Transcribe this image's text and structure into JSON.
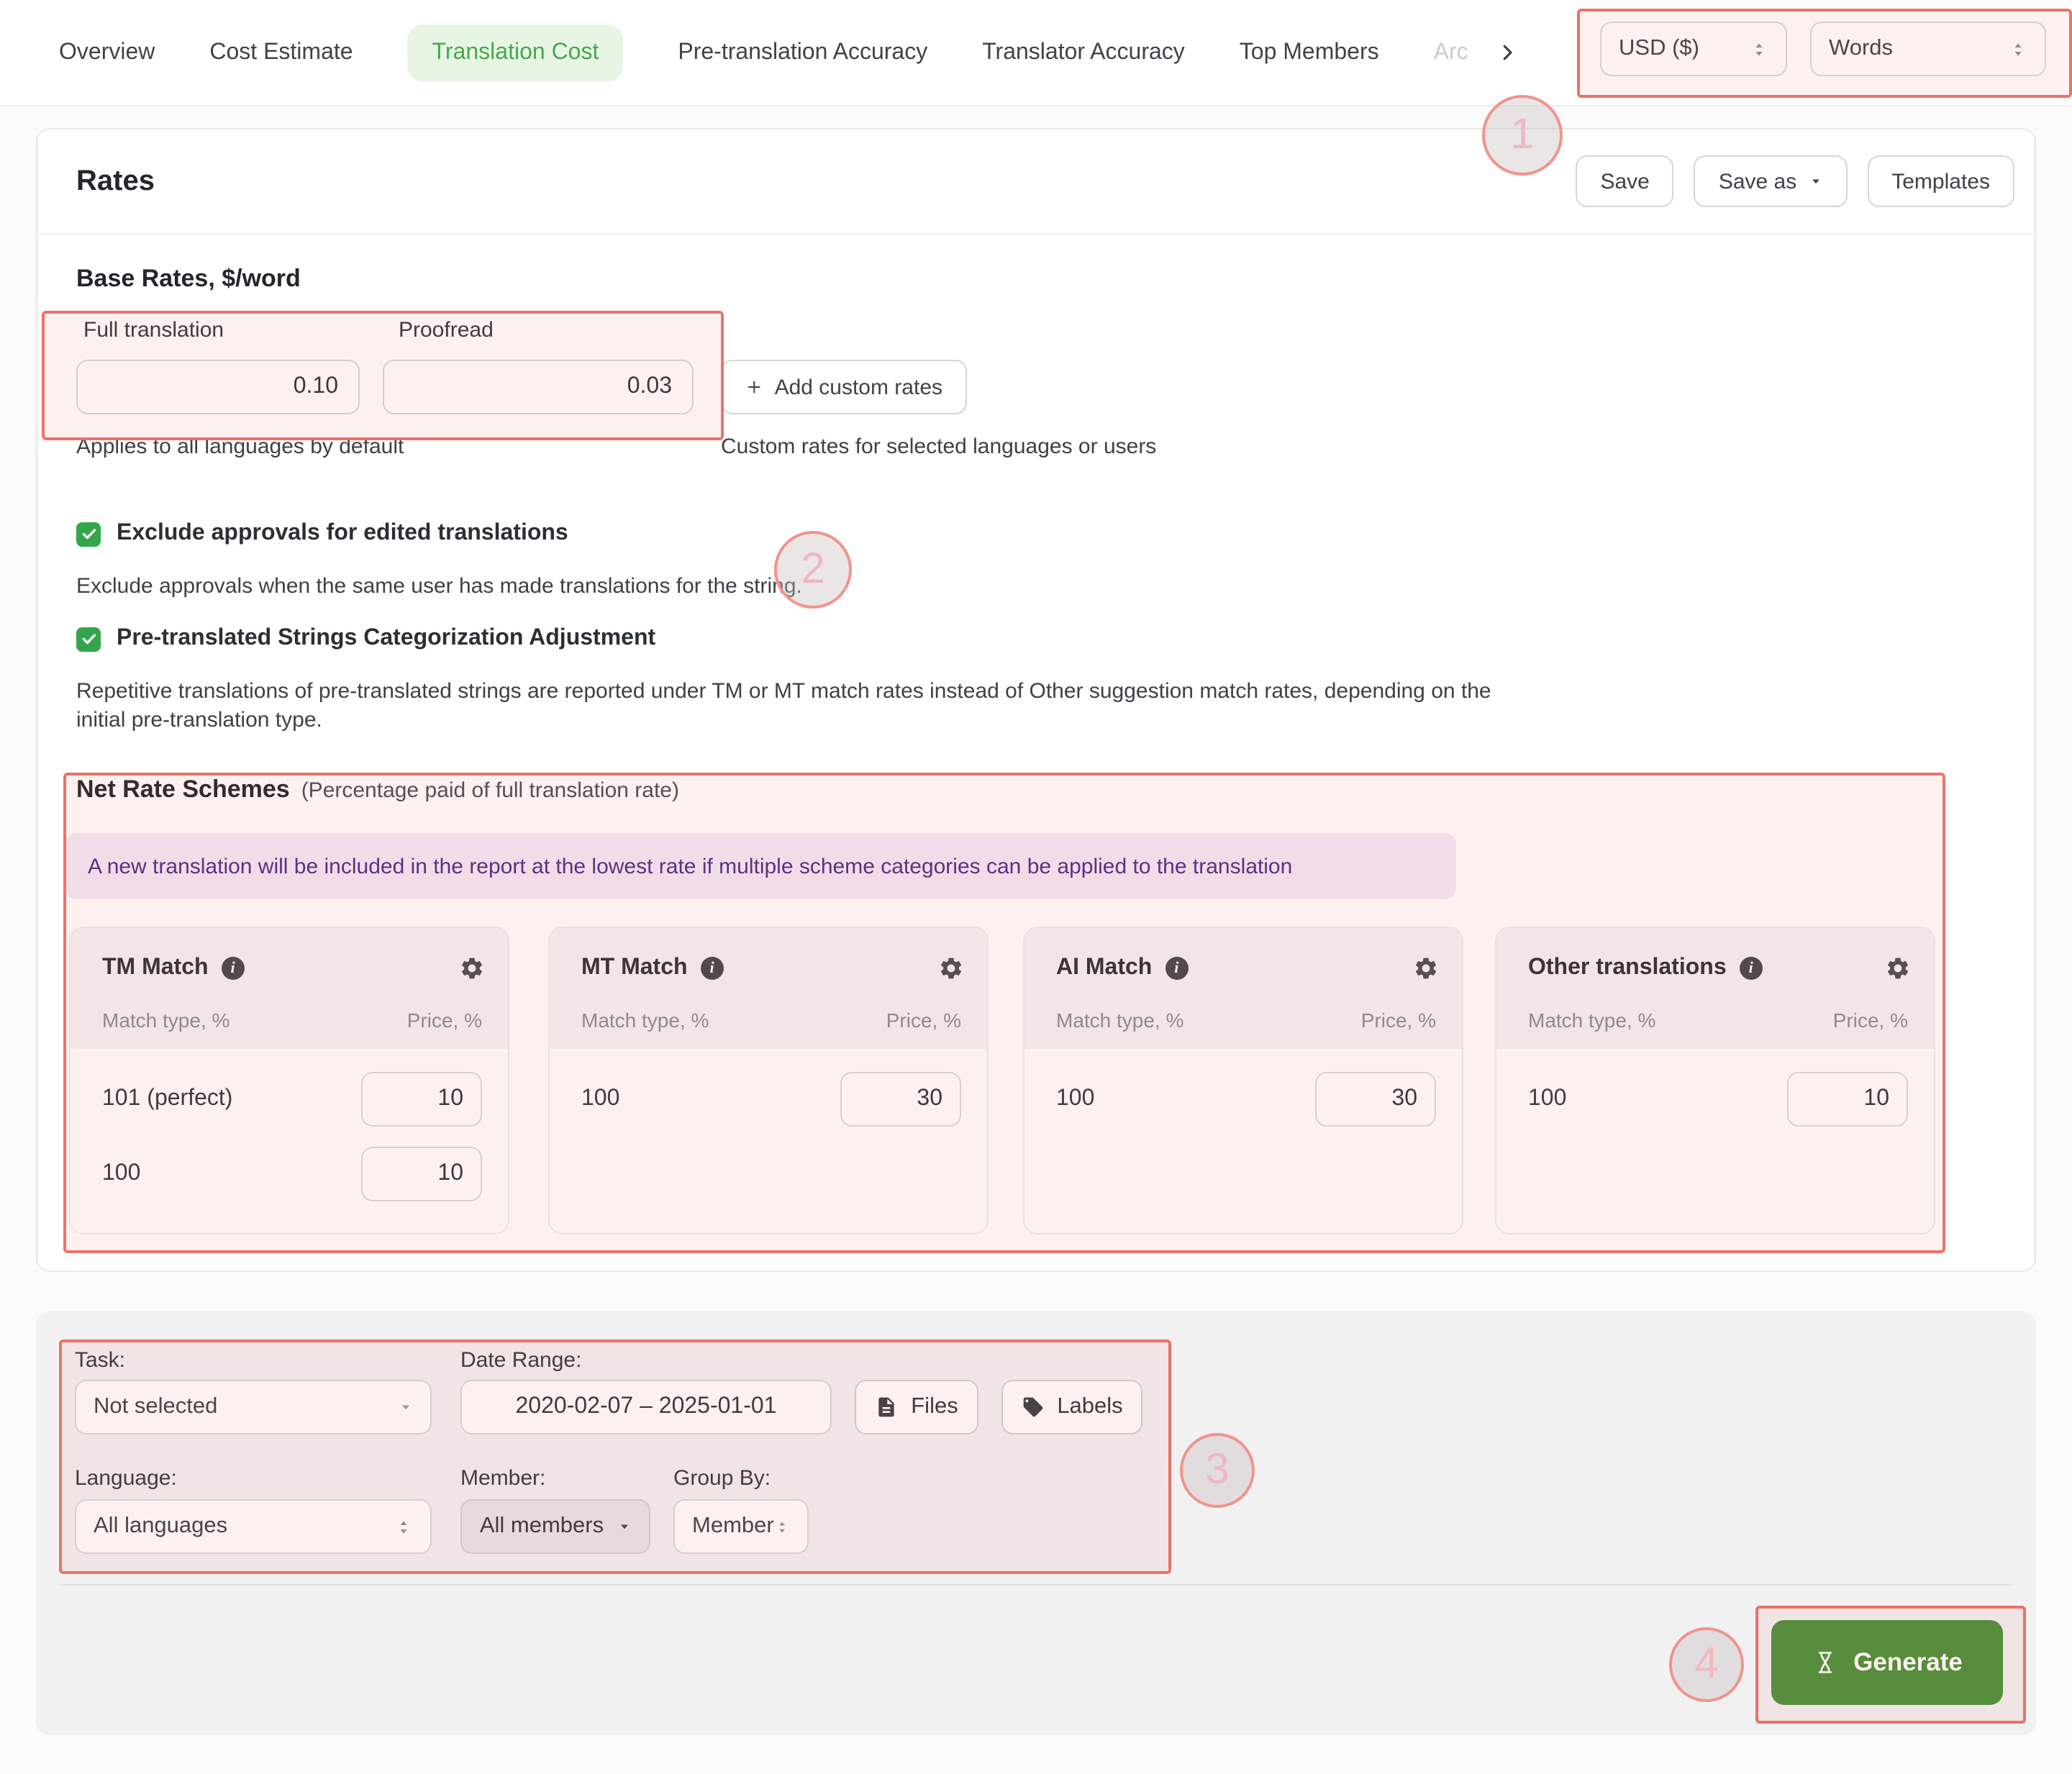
{
  "nav": {
    "tabs": [
      "Overview",
      "Cost Estimate",
      "Translation Cost",
      "Pre-translation Accuracy",
      "Translator Accuracy",
      "Top Members"
    ],
    "truncated_tab": "Arc",
    "currency": "USD ($)",
    "units": "Words"
  },
  "rates_panel": {
    "title": "Rates",
    "save": "Save",
    "save_as": "Save as",
    "templates": "Templates",
    "base_rates": {
      "heading": "Base Rates, $/word",
      "full_label": "Full translation",
      "full_value": "0.10",
      "proofread_label": "Proofread",
      "proofread_value": "0.03",
      "add_custom": "Add custom rates",
      "note_left": "Applies to all languages by default",
      "note_right": "Custom rates for selected languages or users"
    },
    "options": [
      {
        "label": "Exclude approvals for edited translations",
        "description": "Exclude approvals when the same user has made translations for the string.",
        "checked": true
      },
      {
        "label": "Pre-translated Strings Categorization Adjustment",
        "description": "Repetitive translations of pre-translated strings are reported under TM or MT match rates instead of Other suggestion match rates, depending on the initial pre-translation type.",
        "checked": true
      }
    ],
    "net_rate_schemes": {
      "heading": "Net Rate Schemes",
      "subheading": "(Percentage paid of full translation rate)",
      "info": "A new translation will be included in the report at the lowest rate if multiple scheme categories can be applied to the translation",
      "match_type_col": "Match type, %",
      "price_col": "Price, %",
      "cards": [
        {
          "title": "TM Match",
          "rows": [
            {
              "match": "101 (perfect)",
              "price": "10"
            },
            {
              "match": "100",
              "price": "10"
            }
          ]
        },
        {
          "title": "MT Match",
          "rows": [
            {
              "match": "100",
              "price": "30"
            }
          ]
        },
        {
          "title": "AI Match",
          "rows": [
            {
              "match": "100",
              "price": "30"
            }
          ]
        },
        {
          "title": "Other translations",
          "rows": [
            {
              "match": "100",
              "price": "10"
            }
          ]
        }
      ]
    }
  },
  "filters": {
    "task_label": "Task:",
    "task_value": "Not selected",
    "date_label": "Date Range:",
    "date_value": "2020-02-07 – 2025-01-01",
    "files": "Files",
    "labels": "Labels",
    "language_label": "Language:",
    "language_value": "All languages",
    "member_label": "Member:",
    "member_value": "All members",
    "group_label": "Group By:",
    "group_value": "Member"
  },
  "generate_label": "Generate",
  "annotations": {
    "one": "1",
    "two": "2",
    "three": "3",
    "four": "4"
  },
  "icons": {
    "sorter": "up-down-triangles",
    "caret": "triangle-down",
    "chevron": "chevron-right",
    "info": "i-in-circle",
    "gear": "gear",
    "plus": "plus",
    "files": "document",
    "labels": "tag",
    "generate": "hourglass",
    "checkbox": "checkmark"
  },
  "colors": {
    "tab_active_bg": "#e8f5e4",
    "tab_active_text": "#44a94e",
    "checkbox_green": "#33a64c",
    "generate_green": "#4a923c",
    "annotation_red": "#ec7266",
    "info_text_purple": "#4f2d87",
    "info_bg_purple": "#f1eaf7"
  }
}
